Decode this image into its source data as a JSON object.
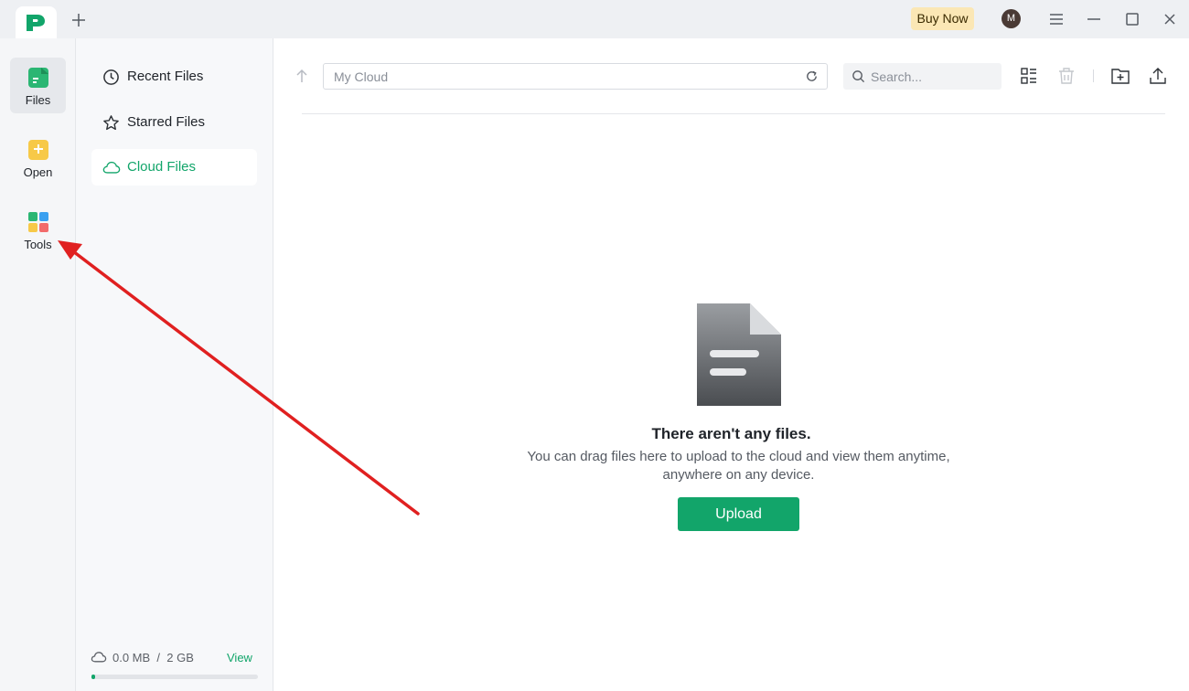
{
  "titlebar": {
    "buy_now_label": "Buy Now",
    "avatar_initial": "M"
  },
  "rail": {
    "items": [
      {
        "label": "Files",
        "icon": "files-icon",
        "active": true
      },
      {
        "label": "Open",
        "icon": "open-file-icon",
        "active": false
      },
      {
        "label": "Tools",
        "icon": "tools-icon",
        "active": false
      }
    ]
  },
  "sidebar": {
    "items": [
      {
        "label": "Recent Files",
        "icon": "clock-icon",
        "active": false
      },
      {
        "label": "Starred Files",
        "icon": "star-icon",
        "active": false
      },
      {
        "label": "Cloud Files",
        "icon": "cloud-icon",
        "active": true
      }
    ],
    "storage": {
      "used": "0.0 MB",
      "separator": "/",
      "total": "2 GB",
      "usage_fraction": 0.02,
      "view_label": "View"
    }
  },
  "toolbar": {
    "path": "My Cloud",
    "search_placeholder": "Search..."
  },
  "empty_state": {
    "title": "There aren't any files.",
    "description": "You can drag files here to upload to the cloud and view them anytime, anywhere on any device.",
    "upload_label": "Upload"
  },
  "colors": {
    "accent": "#12a56a",
    "buy_now_bg": "#fbe7b5",
    "annotation_arrow": "#e02020"
  }
}
